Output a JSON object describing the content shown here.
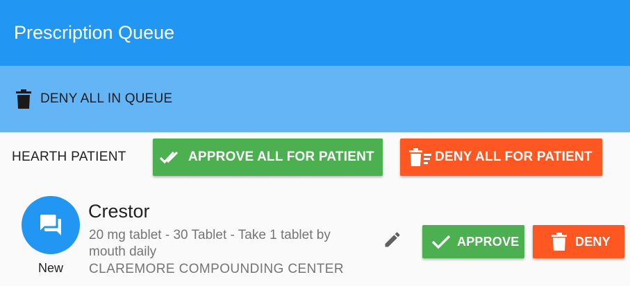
{
  "app": {
    "title": "Prescription Queue"
  },
  "toolbar": {
    "deny_all_label": "DENY ALL IN QUEUE",
    "icon": "trash-icon"
  },
  "patient": {
    "name": "HEARTH PATIENT",
    "approve_all_label": "APPROVE ALL FOR PATIENT",
    "deny_all_label": "DENY ALL FOR PATIENT"
  },
  "prescriptions": [
    {
      "status": "New",
      "drug": "Crestor",
      "detail": "20 mg tablet - 30 Tablet - Take 1 tablet by mouth daily",
      "pharmacy": "CLAREMORE COMPOUNDING CENTER",
      "approve_label": "APPROVE",
      "deny_label": "DENY",
      "avatar_icon": "chat-icon"
    }
  ],
  "colors": {
    "primary": "#2196f3",
    "primary_light": "#64b5f6",
    "approve": "#4caf50",
    "deny": "#ff5722"
  }
}
